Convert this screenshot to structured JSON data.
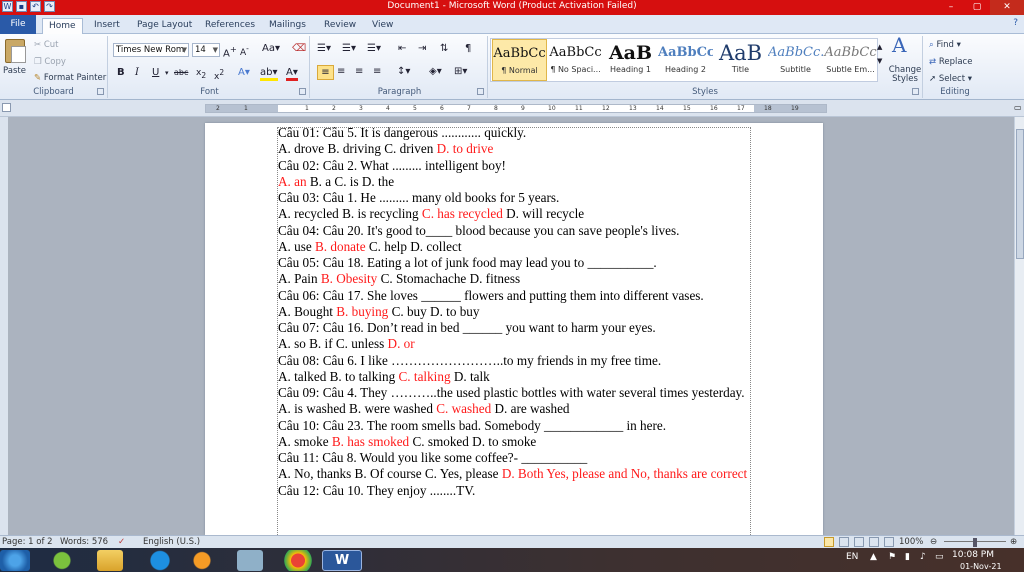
{
  "window": {
    "title": "Document1 - Microsoft Word (Product Activation Failed)"
  },
  "tabs": [
    "File",
    "Home",
    "Insert",
    "Page Layout",
    "References",
    "Mailings",
    "Review",
    "View"
  ],
  "clipboard": {
    "paste": "Paste",
    "cut": "Cut",
    "copy": "Copy",
    "format_painter": "Format Painter",
    "label": "Clipboard"
  },
  "font": {
    "name": "Times New Rom",
    "size": "14",
    "label": "Font"
  },
  "paragraph": {
    "label": "Paragraph"
  },
  "styles": {
    "label": "Styles",
    "items": [
      {
        "preview": "AaBbCc",
        "name": "¶ Normal"
      },
      {
        "preview": "AaBbCc",
        "name": "¶ No Spaci..."
      },
      {
        "preview": "AaB",
        "name": "Heading 1"
      },
      {
        "preview": "AaBbCc",
        "name": "Heading 2"
      },
      {
        "preview": "AaB",
        "name": "Title"
      },
      {
        "preview": "AaBbCc.",
        "name": "Subtitle"
      },
      {
        "preview": "AaBbCc",
        "name": "Subtle Em..."
      }
    ],
    "change_styles": "Change Styles"
  },
  "editing": {
    "label": "Editing",
    "find": "Find",
    "replace": "Replace",
    "select": "Select"
  },
  "ruler_ticks": [
    "1",
    "2",
    "1",
    "2",
    "3",
    "4",
    "5",
    "6",
    "7",
    "8",
    "9",
    "10",
    "11",
    "12",
    "13",
    "14",
    "15",
    "16",
    "17",
    "18",
    "19"
  ],
  "document": {
    "lines": [
      [
        {
          "t": "Câu 01: Câu 5. It is dangerous ............ quickly."
        }
      ],
      [
        {
          "t": " A. drove B. driving C. driven "
        },
        {
          "t": "D. to drive",
          "c": "r"
        }
      ],
      [
        {
          "t": "Câu 02: Câu 2. What ......... intelligent boy!"
        }
      ],
      [
        {
          "t": " "
        },
        {
          "t": "A. an",
          "c": "r"
        },
        {
          "t": " B. a C. is D. the"
        }
      ],
      [
        {
          "t": "Câu 03: Câu 1. He ......... many old books for 5 years."
        }
      ],
      [
        {
          "t": " A. recycled B. is recycling "
        },
        {
          "t": "C. has recycled",
          "c": "r"
        },
        {
          "t": " D. will recycle"
        }
      ],
      [
        {
          "t": "Câu 04: Câu 20. It's good to____ blood because you can save people's lives."
        }
      ],
      [
        {
          "t": "A. use "
        },
        {
          "t": "B. donate",
          "c": "r"
        },
        {
          "t": " C. help D. collect"
        }
      ],
      [
        {
          "t": "Câu 05: Câu 18. Eating a lot of junk food may lead you to __________."
        }
      ],
      [
        {
          "t": "A. Pain "
        },
        {
          "t": "B. Obesity",
          "c": "r"
        },
        {
          "t": " C. Stomachache D. fitness"
        }
      ],
      [
        {
          "t": "Câu 06: Câu 17. She loves ______ flowers and putting them into different vases."
        }
      ],
      [
        {
          "t": "A. Bought "
        },
        {
          "t": "B. buying",
          "c": "r"
        },
        {
          "t": " C. buy D. to buy"
        }
      ],
      [
        {
          "t": "Câu 07: Câu 16. Don’t read in bed ______ you want to harm your eyes."
        }
      ],
      [
        {
          "t": " A. so B. if C. unless "
        },
        {
          "t": "D. or",
          "c": "r"
        }
      ],
      [
        {
          "t": "Câu 08: Câu 6. I like ……………………..to my friends in my free time."
        }
      ],
      [
        {
          "t": "A. talked B. to talking "
        },
        {
          "t": "C. talking",
          "c": "r"
        },
        {
          "t": " D. talk"
        }
      ],
      [
        {
          "t": "Câu 09: Câu 4. They ………..the used plastic bottles with water several times yesterday."
        }
      ],
      [
        {
          "t": " A. is washed B. were washed "
        },
        {
          "t": "C. washed",
          "c": "r"
        },
        {
          "t": " D. are washed"
        }
      ],
      [
        {
          "t": " Câu 10: Câu 23. The room smells bad. Somebody ____________ in here."
        }
      ],
      [
        {
          "t": "A. smoke "
        },
        {
          "t": "B. has smoked",
          "c": "r"
        },
        {
          "t": " C. smoked D. to smoke"
        }
      ],
      [
        {
          "t": "Câu 11: Câu 8. Would you like some coffee?- __________"
        }
      ],
      [
        {
          "t": "A. No, thanks B. Of course C. Yes, please "
        },
        {
          "t": "D. Both Yes, please and No, thanks are correct",
          "c": "r"
        }
      ],
      [
        {
          "t": "Câu 12: Câu 10. They enjoy ........TV."
        }
      ]
    ]
  },
  "status": {
    "page": "Page: 1 of 2",
    "words": "Words: 576",
    "language": "English (U.S.)",
    "zoom": "100%"
  },
  "taskbar": {
    "lang": "EN",
    "time": "10:08 PM",
    "date": "01-Nov-21"
  },
  "colors": {
    "answer": "#ff1a1a",
    "titlebar": "#d60f0f",
    "file_tab": "#2a5aa8"
  }
}
